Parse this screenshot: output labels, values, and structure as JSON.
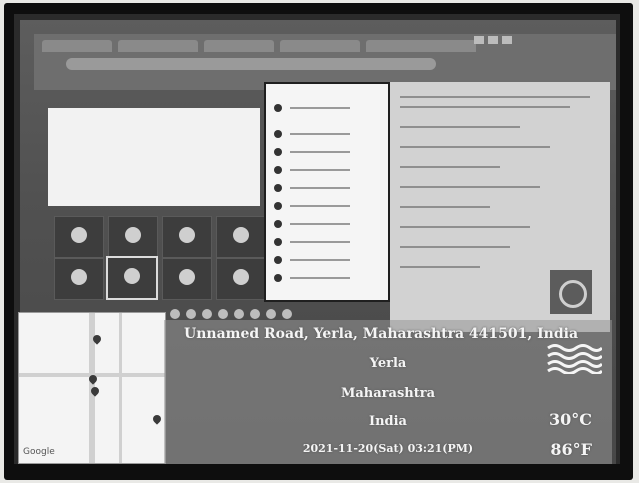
{
  "overlay": {
    "address": "Unnamed Road, Yerla, Maharashtra 441501, India",
    "city": "Yerla",
    "state": "Maharashtra",
    "country": "India",
    "datetime": "2021-11-20(Sat) 03:21(PM)",
    "temp_c": "30°C",
    "temp_f": "86°F",
    "weather_icon": "haze-icon"
  },
  "map": {
    "logo": "Google"
  }
}
